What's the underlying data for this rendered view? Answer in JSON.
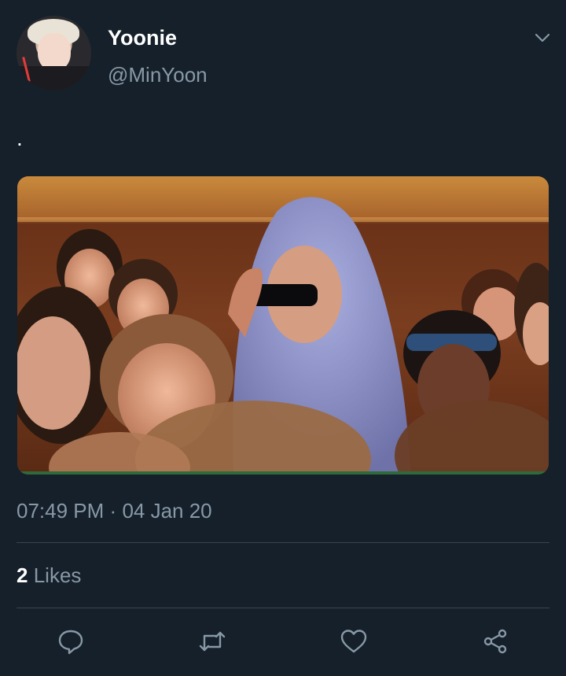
{
  "user": {
    "display_name": "Yoonie",
    "handle": "@MinYoon"
  },
  "tweet": {
    "text": "."
  },
  "media": {
    "image": "crowd-hoodie-sunglasses-photo"
  },
  "meta": {
    "time": "07:49 PM",
    "separator": "·",
    "date": "04 Jan 20"
  },
  "stats": {
    "likes_count": "2",
    "likes_label": "Likes"
  },
  "actions": [
    {
      "name": "reply",
      "icon": "reply-icon"
    },
    {
      "name": "retweet",
      "icon": "retweet-icon"
    },
    {
      "name": "like",
      "icon": "heart-icon"
    },
    {
      "name": "share",
      "icon": "share-icon"
    }
  ],
  "colors": {
    "background": "#15202b",
    "secondary_text": "#8899a6",
    "divider": "#38444d",
    "primary_text": "#ffffff"
  }
}
